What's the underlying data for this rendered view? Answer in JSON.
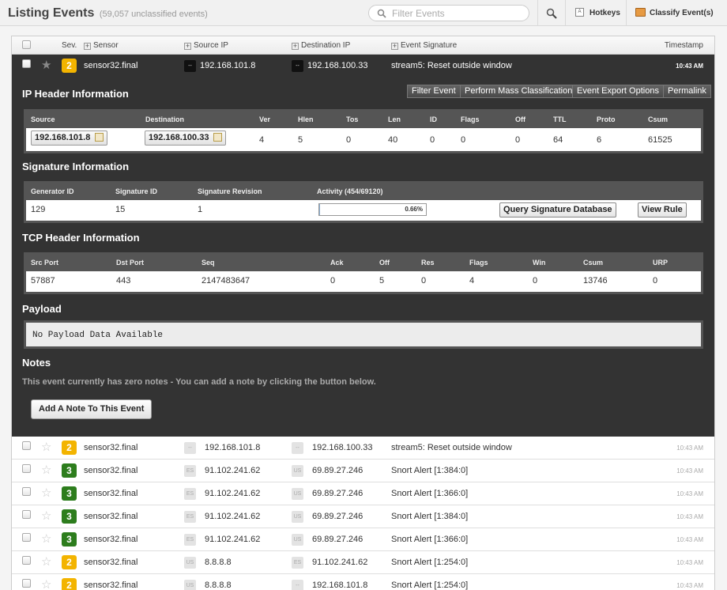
{
  "header": {
    "title": "Listing Events",
    "subtitle": "(59,057 unclassified events)",
    "search_placeholder": "Filter Events",
    "hotkeys_label": "Hotkeys",
    "classify_label": "Classify Event(s)"
  },
  "columns": {
    "sev": "Sev.",
    "sensor": "Sensor",
    "source_ip": "Source IP",
    "destination_ip": "Destination IP",
    "event_signature": "Event Signature",
    "timestamp": "Timestamp"
  },
  "colors": {
    "sev2": "#f3b400",
    "sev3": "#2d7d1d",
    "detail_bg": "#333333"
  },
  "selected_event": {
    "sev": "2",
    "sensor": "sensor32.final",
    "src_flag": "--",
    "source_ip": "192.168.101.8",
    "dst_flag": "--",
    "destination_ip": "192.168.100.33",
    "signature": "stream5: Reset outside window",
    "timestamp": "10:43 AM"
  },
  "detail": {
    "ip_header_title": "IP Header Information",
    "buttons": [
      "Filter Event",
      "Perform Mass Classification",
      "Event Export Options",
      "Permalink"
    ],
    "ip_cols": [
      "Source",
      "Destination",
      "Ver",
      "Hlen",
      "Tos",
      "Len",
      "ID",
      "Flags",
      "Off",
      "TTL",
      "Proto",
      "Csum"
    ],
    "ip_vals": [
      "192.168.101.8",
      "192.168.100.33",
      "4",
      "5",
      "0",
      "40",
      "0",
      "0",
      "0",
      "64",
      "6",
      "61525"
    ],
    "sig_title": "Signature Information",
    "sig_cols": [
      "Generator ID",
      "Signature ID",
      "Signature Revision",
      "Activity (454/69120)"
    ],
    "sig_vals": [
      "129",
      "15",
      "1"
    ],
    "activity_pct": "0.66%",
    "activity_fraction": 0.0066,
    "query_button": "Query Signature Database",
    "view_rule_button": "View Rule",
    "tcp_title": "TCP Header Information",
    "tcp_cols": [
      "Src Port",
      "Dst Port",
      "Seq",
      "Ack",
      "Off",
      "Res",
      "Flags",
      "Win",
      "Csum",
      "URP"
    ],
    "tcp_vals": [
      "57887",
      "443",
      "2147483647",
      "0",
      "5",
      "0",
      "4",
      "0",
      "13746",
      "0"
    ],
    "payload_title": "Payload",
    "payload_text": "No Payload Data Available",
    "notes_title": "Notes",
    "notes_text": "This event currently has zero notes - You can add a note by clicking the button below.",
    "add_note_button": "Add A Note To This Event"
  },
  "events": [
    {
      "sev": "2",
      "sensor": "sensor32.final",
      "src_flag": "--",
      "source_ip": "192.168.101.8",
      "dst_flag": "--",
      "destination_ip": "192.168.100.33",
      "signature": "stream5: Reset outside window",
      "timestamp": "10:43 AM"
    },
    {
      "sev": "3",
      "sensor": "sensor32.final",
      "src_flag": "ES",
      "source_ip": "91.102.241.62",
      "dst_flag": "US",
      "destination_ip": "69.89.27.246",
      "signature": "Snort Alert [1:384:0]",
      "timestamp": "10:43 AM"
    },
    {
      "sev": "3",
      "sensor": "sensor32.final",
      "src_flag": "ES",
      "source_ip": "91.102.241.62",
      "dst_flag": "US",
      "destination_ip": "69.89.27.246",
      "signature": "Snort Alert [1:366:0]",
      "timestamp": "10:43 AM"
    },
    {
      "sev": "3",
      "sensor": "sensor32.final",
      "src_flag": "ES",
      "source_ip": "91.102.241.62",
      "dst_flag": "US",
      "destination_ip": "69.89.27.246",
      "signature": "Snort Alert [1:384:0]",
      "timestamp": "10:43 AM"
    },
    {
      "sev": "3",
      "sensor": "sensor32.final",
      "src_flag": "ES",
      "source_ip": "91.102.241.62",
      "dst_flag": "US",
      "destination_ip": "69.89.27.246",
      "signature": "Snort Alert [1:366:0]",
      "timestamp": "10:43 AM"
    },
    {
      "sev": "2",
      "sensor": "sensor32.final",
      "src_flag": "US",
      "source_ip": "8.8.8.8",
      "dst_flag": "ES",
      "destination_ip": "91.102.241.62",
      "signature": "Snort Alert [1:254:0]",
      "timestamp": "10:43 AM"
    },
    {
      "sev": "2",
      "sensor": "sensor32.final",
      "src_flag": "US",
      "source_ip": "8.8.8.8",
      "dst_flag": "--",
      "destination_ip": "192.168.101.8",
      "signature": "Snort Alert [1:254:0]",
      "timestamp": "10:43 AM"
    }
  ]
}
